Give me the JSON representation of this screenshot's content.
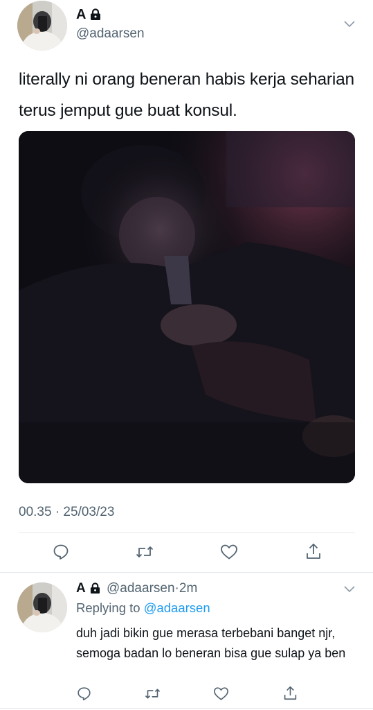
{
  "tweet": {
    "author_name": "A",
    "handle": "@adaarsen",
    "text": "literally ni orang beneran habis kerja seharian terus jemput gue buat konsul.",
    "timestamp": "00.35 · 25/03/23",
    "icons": [
      "lock-icon",
      "chevron-down-icon",
      "reply-icon",
      "retweet-icon",
      "like-icon",
      "share-icon"
    ]
  },
  "reply": {
    "author_name": "A",
    "handle": "@adaarsen",
    "separator": "·",
    "time_ago": "2m",
    "replying_prefix": "Replying to",
    "replying_to": "@adaarsen",
    "text": "duh jadi bikin gue merasa terbebani banget njr, semoga badan lo beneran bisa gue sulap ya ben"
  },
  "colors": {
    "text": "#0f1419",
    "secondary": "#536471",
    "link": "#1d9bf0",
    "divider": "#e3e6ea"
  }
}
